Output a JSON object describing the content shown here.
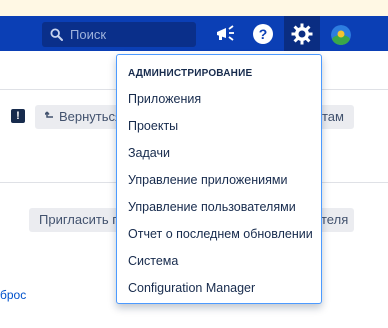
{
  "header": {
    "search_placeholder": "Поиск",
    "icons": [
      "search-icon",
      "megaphone-icon",
      "help-icon",
      "gear-icon",
      "avatar"
    ],
    "colors": {
      "header_bg": "#0b3fb5",
      "menu_border": "#4c9aff"
    }
  },
  "toolbar": {
    "back_button_label": "Вернуться",
    "back_button_tail": "там",
    "invite_button_label": "Пригласить п",
    "invite_button_tail": "теля"
  },
  "page": {
    "reset_link": "брос"
  },
  "admin_menu": {
    "heading": "АДМИНИСТРИРОВАНИЕ",
    "items": [
      {
        "label": "Приложения"
      },
      {
        "label": "Проекты"
      },
      {
        "label": "Задачи"
      },
      {
        "label": "Управление приложениями"
      },
      {
        "label": "Управление пользователями"
      },
      {
        "label": "Отчет о последнем обновлении"
      },
      {
        "label": "Система"
      },
      {
        "label": "Configuration Manager"
      }
    ]
  }
}
